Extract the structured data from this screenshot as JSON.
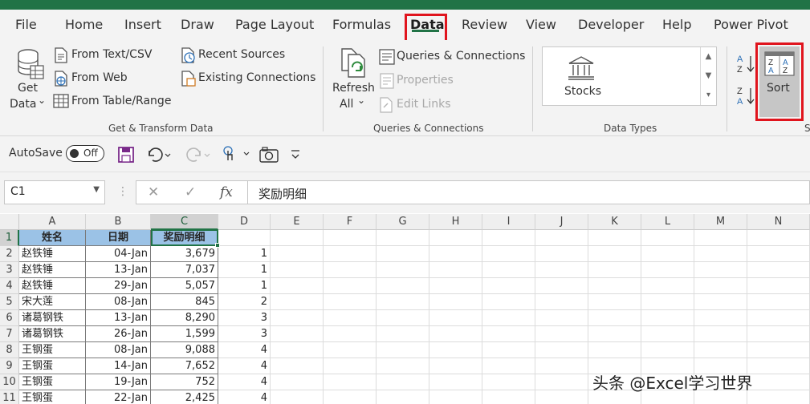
{
  "tabs": [
    {
      "label": "File"
    },
    {
      "label": "Home"
    },
    {
      "label": "Insert"
    },
    {
      "label": "Draw"
    },
    {
      "label": "Page Layout"
    },
    {
      "label": "Formulas"
    },
    {
      "label": "Data"
    },
    {
      "label": "Review"
    },
    {
      "label": "View"
    },
    {
      "label": "Developer"
    },
    {
      "label": "Help"
    },
    {
      "label": "Power Pivot"
    }
  ],
  "ribbon": {
    "get_data": {
      "line1": "Get",
      "line2": "Data",
      "caret": "⌄"
    },
    "from_text_csv": "From Text/CSV",
    "from_web": "From Web",
    "from_table_range": "From Table/Range",
    "recent_sources": "Recent Sources",
    "existing_connections": "Existing Connections",
    "group_get_transform": "Get & Transform Data",
    "refresh": {
      "line1": "Refresh",
      "line2": "All",
      "caret": "⌄"
    },
    "queries_connections": "Queries & Connections",
    "properties": "Properties",
    "edit_links": "Edit Links",
    "group_queries": "Queries & Connections",
    "stocks": "Stocks",
    "group_data_types": "Data Types",
    "sort": "Sort",
    "group_sort_partial": "S"
  },
  "qat": {
    "autosave": "AutoSave",
    "toggle_state": "Off"
  },
  "formula_bar": {
    "name_box": "C1",
    "formula": "奖励明细"
  },
  "columns": [
    "A",
    "B",
    "C",
    "D",
    "E",
    "F",
    "G",
    "H",
    "I",
    "J",
    "K",
    "L",
    "M",
    "N"
  ],
  "rows": [
    "1",
    "2",
    "3",
    "4",
    "5",
    "6",
    "7",
    "8",
    "9",
    "10",
    "11"
  ],
  "table": {
    "headers": [
      "姓名",
      "日期",
      "奖励明细"
    ],
    "data": [
      [
        "赵铁锤",
        "04-Jan",
        "3,679",
        "1"
      ],
      [
        "赵铁锤",
        "13-Jan",
        "7,037",
        "1"
      ],
      [
        "赵铁锤",
        "29-Jan",
        "5,057",
        "1"
      ],
      [
        "宋大莲",
        "08-Jan",
        "845",
        "2"
      ],
      [
        "诸葛钢铁",
        "13-Jan",
        "8,290",
        "3"
      ],
      [
        "诸葛钢铁",
        "26-Jan",
        "1,599",
        "3"
      ],
      [
        "王钢蛋",
        "08-Jan",
        "9,088",
        "4"
      ],
      [
        "王钢蛋",
        "14-Jan",
        "7,652",
        "4"
      ],
      [
        "王钢蛋",
        "19-Jan",
        "752",
        "4"
      ],
      [
        "王钢蛋",
        "22-Jan",
        "2,425",
        "4"
      ]
    ]
  },
  "watermark": "头条 @Excel学习世界",
  "colors": {
    "excel_green": "#217346",
    "highlight_red": "#e0141d",
    "header_blue": "#9bc2e6"
  }
}
